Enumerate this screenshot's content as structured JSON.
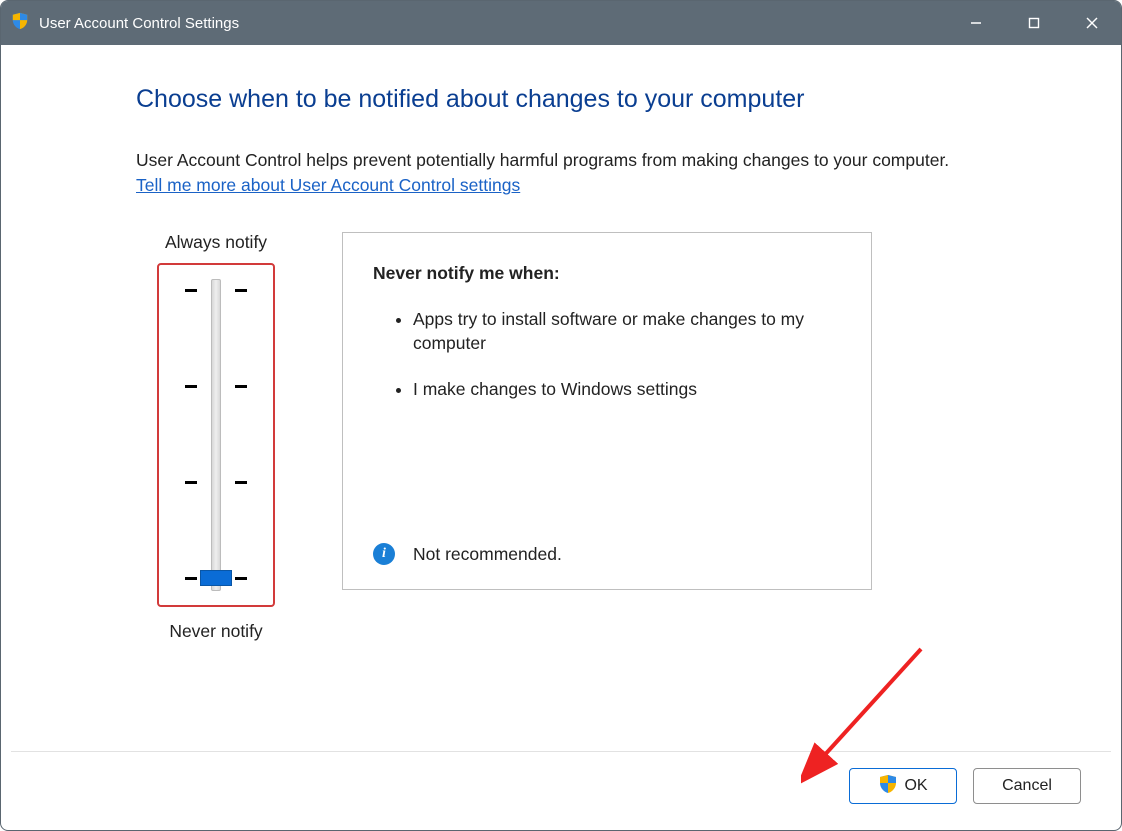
{
  "titlebar": {
    "title": "User Account Control Settings"
  },
  "heading": "Choose when to be notified about changes to your computer",
  "intro": "User Account Control helps prevent potentially harmful programs from making changes to your computer.",
  "help_link": "Tell me more about User Account Control settings",
  "slider": {
    "top_label": "Always notify",
    "bottom_label": "Never notify",
    "levels": 4,
    "current_level": 0
  },
  "panel": {
    "title": "Never notify me when:",
    "bullets": [
      "Apps try to install software or make changes to my computer",
      "I make changes to Windows settings"
    ],
    "status": "Not recommended."
  },
  "buttons": {
    "ok": "OK",
    "cancel": "Cancel"
  },
  "icons": {
    "shield": "shield-icon",
    "info": "info-icon",
    "minimize": "minimize-icon",
    "maximize": "maximize-icon",
    "close": "close-icon"
  },
  "annotation": {
    "highlight": "slider-highlight-red",
    "arrow_target": "ok-button"
  }
}
